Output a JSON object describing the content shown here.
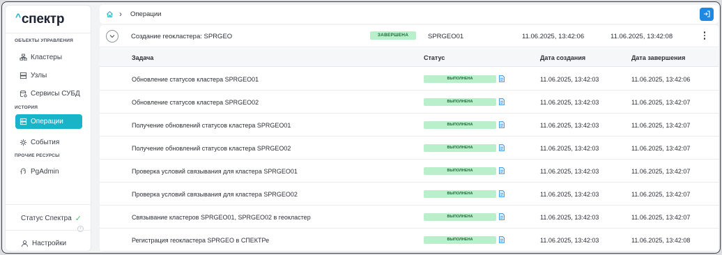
{
  "sidebar": {
    "logo": "спектр",
    "sections": {
      "management": "ОБЪЕКТЫ УПРАВЛЕНИЯ",
      "history": "ИСТОРИЯ",
      "other": "ПРОЧИЕ РЕСУРСЫ"
    },
    "items": [
      {
        "label": "Кластеры",
        "icon": "cluster-icon"
      },
      {
        "label": "Узлы",
        "icon": "nodes-icon"
      },
      {
        "label": "Сервисы СУБД",
        "icon": "db-services-icon"
      },
      {
        "label": "Операции",
        "icon": "operations-icon",
        "active": true
      },
      {
        "label": "События",
        "icon": "events-icon"
      },
      {
        "label": "PgAdmin",
        "icon": "pgadmin-icon"
      }
    ],
    "status_label": "Статус Спектра",
    "settings_label": "Настройки"
  },
  "breadcrumb": {
    "page": "Операции"
  },
  "operation": {
    "name": "Создание геокластера: SPRGEO",
    "status": "ЗАВЕРШЕНА",
    "cluster": "SPRGEO01",
    "created": "11.06.2025, 13:42:06",
    "finished": "11.06.2025, 13:42:08"
  },
  "table": {
    "headers": {
      "task": "Задача",
      "status": "Статус",
      "created": "Дата создания",
      "finished": "Дата завершения"
    },
    "rows": [
      {
        "task": "Обновление статусов кластера SPRGEO01",
        "status": "ВЫПОЛНЕНА",
        "created": "11.06.2025, 13:42:03",
        "finished": "11.06.2025, 13:42:06"
      },
      {
        "task": "Обновление статусов кластера SPRGEO02",
        "status": "ВЫПОЛНЕНА",
        "created": "11.06.2025, 13:42:03",
        "finished": "11.06.2025, 13:42:07"
      },
      {
        "task": "Получение обновлений статусов кластера SPRGEO01",
        "status": "ВЫПОЛНЕНА",
        "created": "11.06.2025, 13:42:03",
        "finished": "11.06.2025, 13:42:07"
      },
      {
        "task": "Получение обновлений статусов кластера SPRGEO02",
        "status": "ВЫПОЛНЕНА",
        "created": "11.06.2025, 13:42:03",
        "finished": "11.06.2025, 13:42:07"
      },
      {
        "task": "Проверка условий связывания для кластера SPRGEO01",
        "status": "ВЫПОЛНЕНА",
        "created": "11.06.2025, 13:42:03",
        "finished": "11.06.2025, 13:42:07"
      },
      {
        "task": "Проверка условий связывания для кластера SPRGEO02",
        "status": "ВЫПОЛНЕНА",
        "created": "11.06.2025, 13:42:03",
        "finished": "11.06.2025, 13:42:07"
      },
      {
        "task": "Связывание кластеров SPRGEO01, SPRGEO02 в геокластер",
        "status": "ВЫПОЛНЕНА",
        "created": "11.06.2025, 13:42:03",
        "finished": "11.06.2025, 13:42:07"
      },
      {
        "task": "Регистрация геокластера SPRGEO в СПЕКТРе",
        "status": "ВЫПОЛНЕНА",
        "created": "11.06.2025, 13:42:03",
        "finished": "11.06.2025, 13:42:08"
      }
    ]
  },
  "colors": {
    "accent": "#19b4c8",
    "success_bg": "#b9efca",
    "button_blue": "#1e88e5"
  }
}
